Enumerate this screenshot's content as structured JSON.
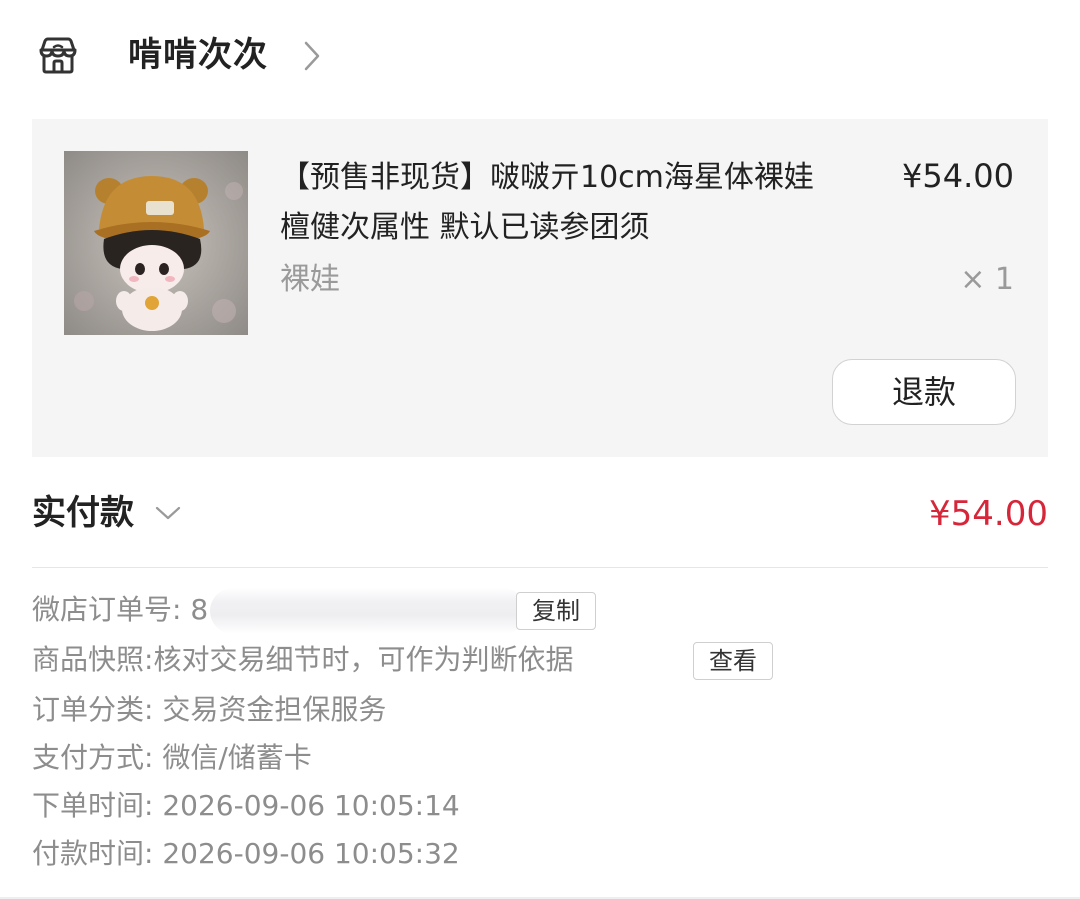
{
  "shop": {
    "name": "啃啃次次"
  },
  "product": {
    "title": "【预售非现货】啵啵亓10cm海星体裸娃 檀健次属性 默认已读参团须",
    "price": "¥54.00",
    "variant": "裸娃",
    "quantity": "× 1",
    "refund_label": "退款"
  },
  "payment": {
    "label": "实付款",
    "amount": "¥54.00",
    "amount_color": "#d6263a"
  },
  "order_info": {
    "order_no_label": "微店订单号:",
    "order_no_visible": "8",
    "copy_label": "复制",
    "snapshot_label": "商品快照:",
    "snapshot_value": "核对交易细节时，可作为判断依据",
    "view_label": "查看",
    "category_label": "订单分类:",
    "category_value": "交易资金担保服务",
    "pay_method_label": "支付方式:",
    "pay_method_value": "微信/储蓄卡",
    "order_time_label": "下单时间:",
    "order_time_value": "2026-09-06 10:05:14",
    "pay_time_label": "付款时间:",
    "pay_time_value": "2026-09-06 10:05:32"
  },
  "icons": {
    "shop": "shop-icon",
    "chevron_right": "chevron-right-icon",
    "chevron_down": "chevron-down-icon"
  }
}
